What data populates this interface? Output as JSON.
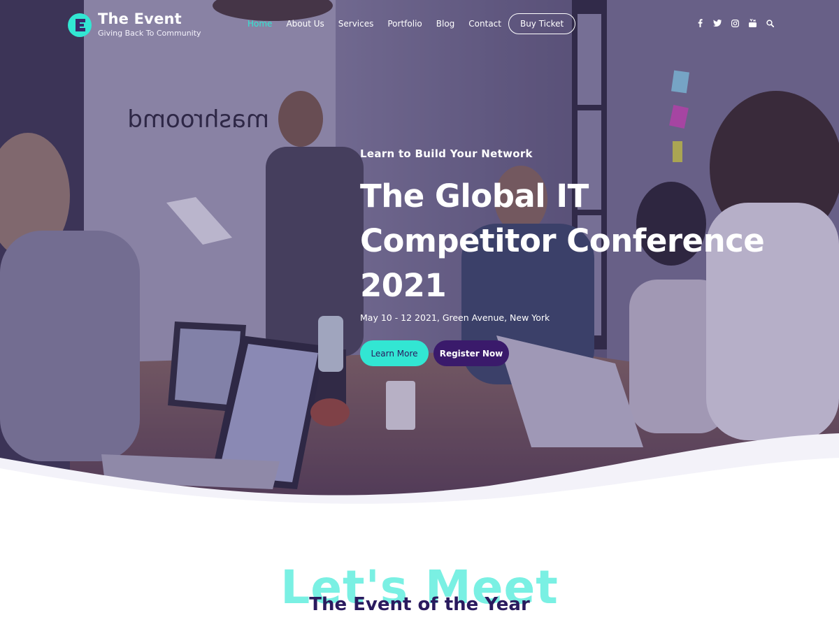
{
  "brand": {
    "title": "The Event",
    "tagline": "Giving Back To Community",
    "accent_color": "#32e6d3",
    "primary_color": "#3a1a6b",
    "logo_icon": "letter-e-logo-icon"
  },
  "nav": {
    "items": [
      {
        "label": "Home",
        "active": true
      },
      {
        "label": "About Us",
        "active": false
      },
      {
        "label": "Services",
        "active": false
      },
      {
        "label": "Portfolio",
        "active": false
      },
      {
        "label": "Blog",
        "active": false
      },
      {
        "label": "Contact",
        "active": false
      }
    ],
    "cta_label": "Buy Ticket"
  },
  "social_icons": [
    "facebook-icon",
    "twitter-icon",
    "instagram-icon",
    "youtube-icon",
    "search-icon"
  ],
  "hero": {
    "eyebrow": "Learn to Build Your Network",
    "headline_line1": "The Global IT",
    "headline_line2": "Competitor Conference",
    "headline_line3": "2021",
    "date_location": "May 10 - 12 2021, Green Avenue, New York",
    "primary_button": "Learn More",
    "secondary_button": "Register Now",
    "wall_sign": "mashroomd"
  },
  "section": {
    "background_text": "Let's Meet",
    "title": "The Event of the Year"
  }
}
